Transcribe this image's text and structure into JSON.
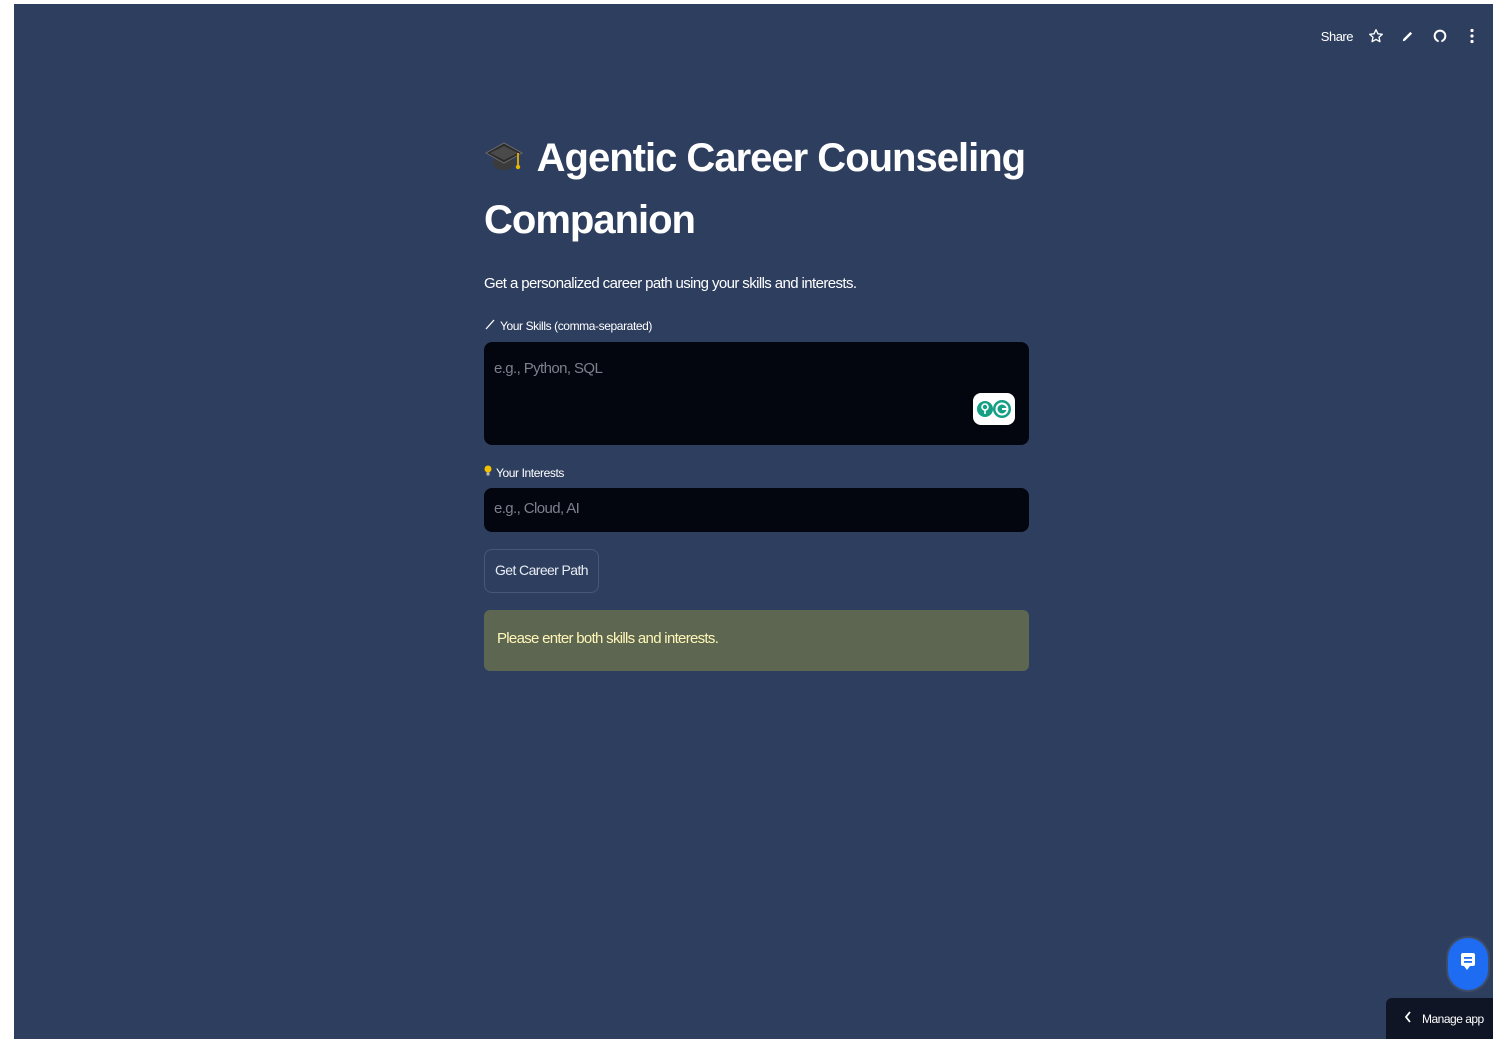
{
  "toolbar": {
    "share_label": "Share"
  },
  "header": {
    "title_line1": "Agentic Career Counseling",
    "title_line2": "Companion",
    "subtitle": "Get a personalized career path using your skills and interests."
  },
  "form": {
    "skills_label": "Your Skills (comma-separated)",
    "skills_placeholder": "e.g., Python, SQL",
    "interests_label": "Your Interests",
    "interests_placeholder": "e.g., Cloud, AI",
    "submit_label": "Get Career Path"
  },
  "alert": {
    "message": "Please enter both skills and interests."
  },
  "footer": {
    "manage_label": "Manage app"
  },
  "icons": [
    "graduation-cap-icon",
    "pencil-icon",
    "lightbulb-icon",
    "star-icon",
    "edit-icon",
    "github-icon",
    "more-vertical-icon",
    "chat-icon",
    "chevron-left-icon"
  ],
  "colors": {
    "background": "#2e3e5e",
    "input_bg": "#04060f",
    "alert_bg": "#5d6650",
    "alert_text": "#fff7b8",
    "accent": "#1d6cf2"
  }
}
